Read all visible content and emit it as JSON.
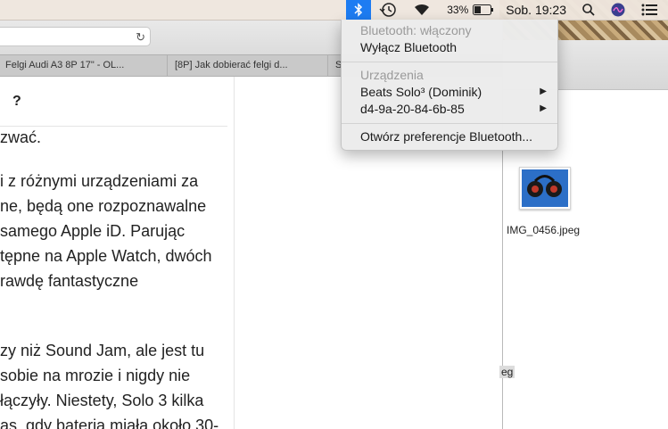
{
  "menubar": {
    "battery_percent": "33%",
    "clock": "Sob. 19:23",
    "icons": [
      "bluetooth-icon",
      "time-machine-icon",
      "wifi-icon",
      "battery-icon",
      "spotlight-icon",
      "siri-icon",
      "notification-center-icon"
    ]
  },
  "bluetooth_menu": {
    "status": "Bluetooth: włączony",
    "toggle": "Wyłącz Bluetooth",
    "devices_header": "Urządzenia",
    "devices": [
      "Beats Solo³ (Dominik)",
      "d4-9a-20-84-6b-85"
    ],
    "preferences": "Otwórz preferencje Bluetooth..."
  },
  "browser": {
    "tabs": [
      "Felgi Audi A3 8P 17\" - OL...",
      "[8P] Jak dobierać felgi d...",
      "S"
    ],
    "heading_fragment": "?",
    "article_lines": [
      "zwać.",
      "i z różnymi urządzeniami za",
      "ne, będą one rozpoznawalne",
      "samego Apple iD. Parując",
      "tępne na Apple Watch, dwóch",
      "rawdę fantastyczne",
      "zy niż Sound Jam, ale jest tu",
      "sobie na mrozie i nigdy nie",
      "łączyły. Niestety, Solo 3 kilka",
      "as, gdy bateria miała około 30-"
    ]
  },
  "finder": {
    "file_name": "IMG_0456.jpeg",
    "file_name_partial": "eg"
  },
  "colors": {
    "accent": "#1d7cf2"
  }
}
